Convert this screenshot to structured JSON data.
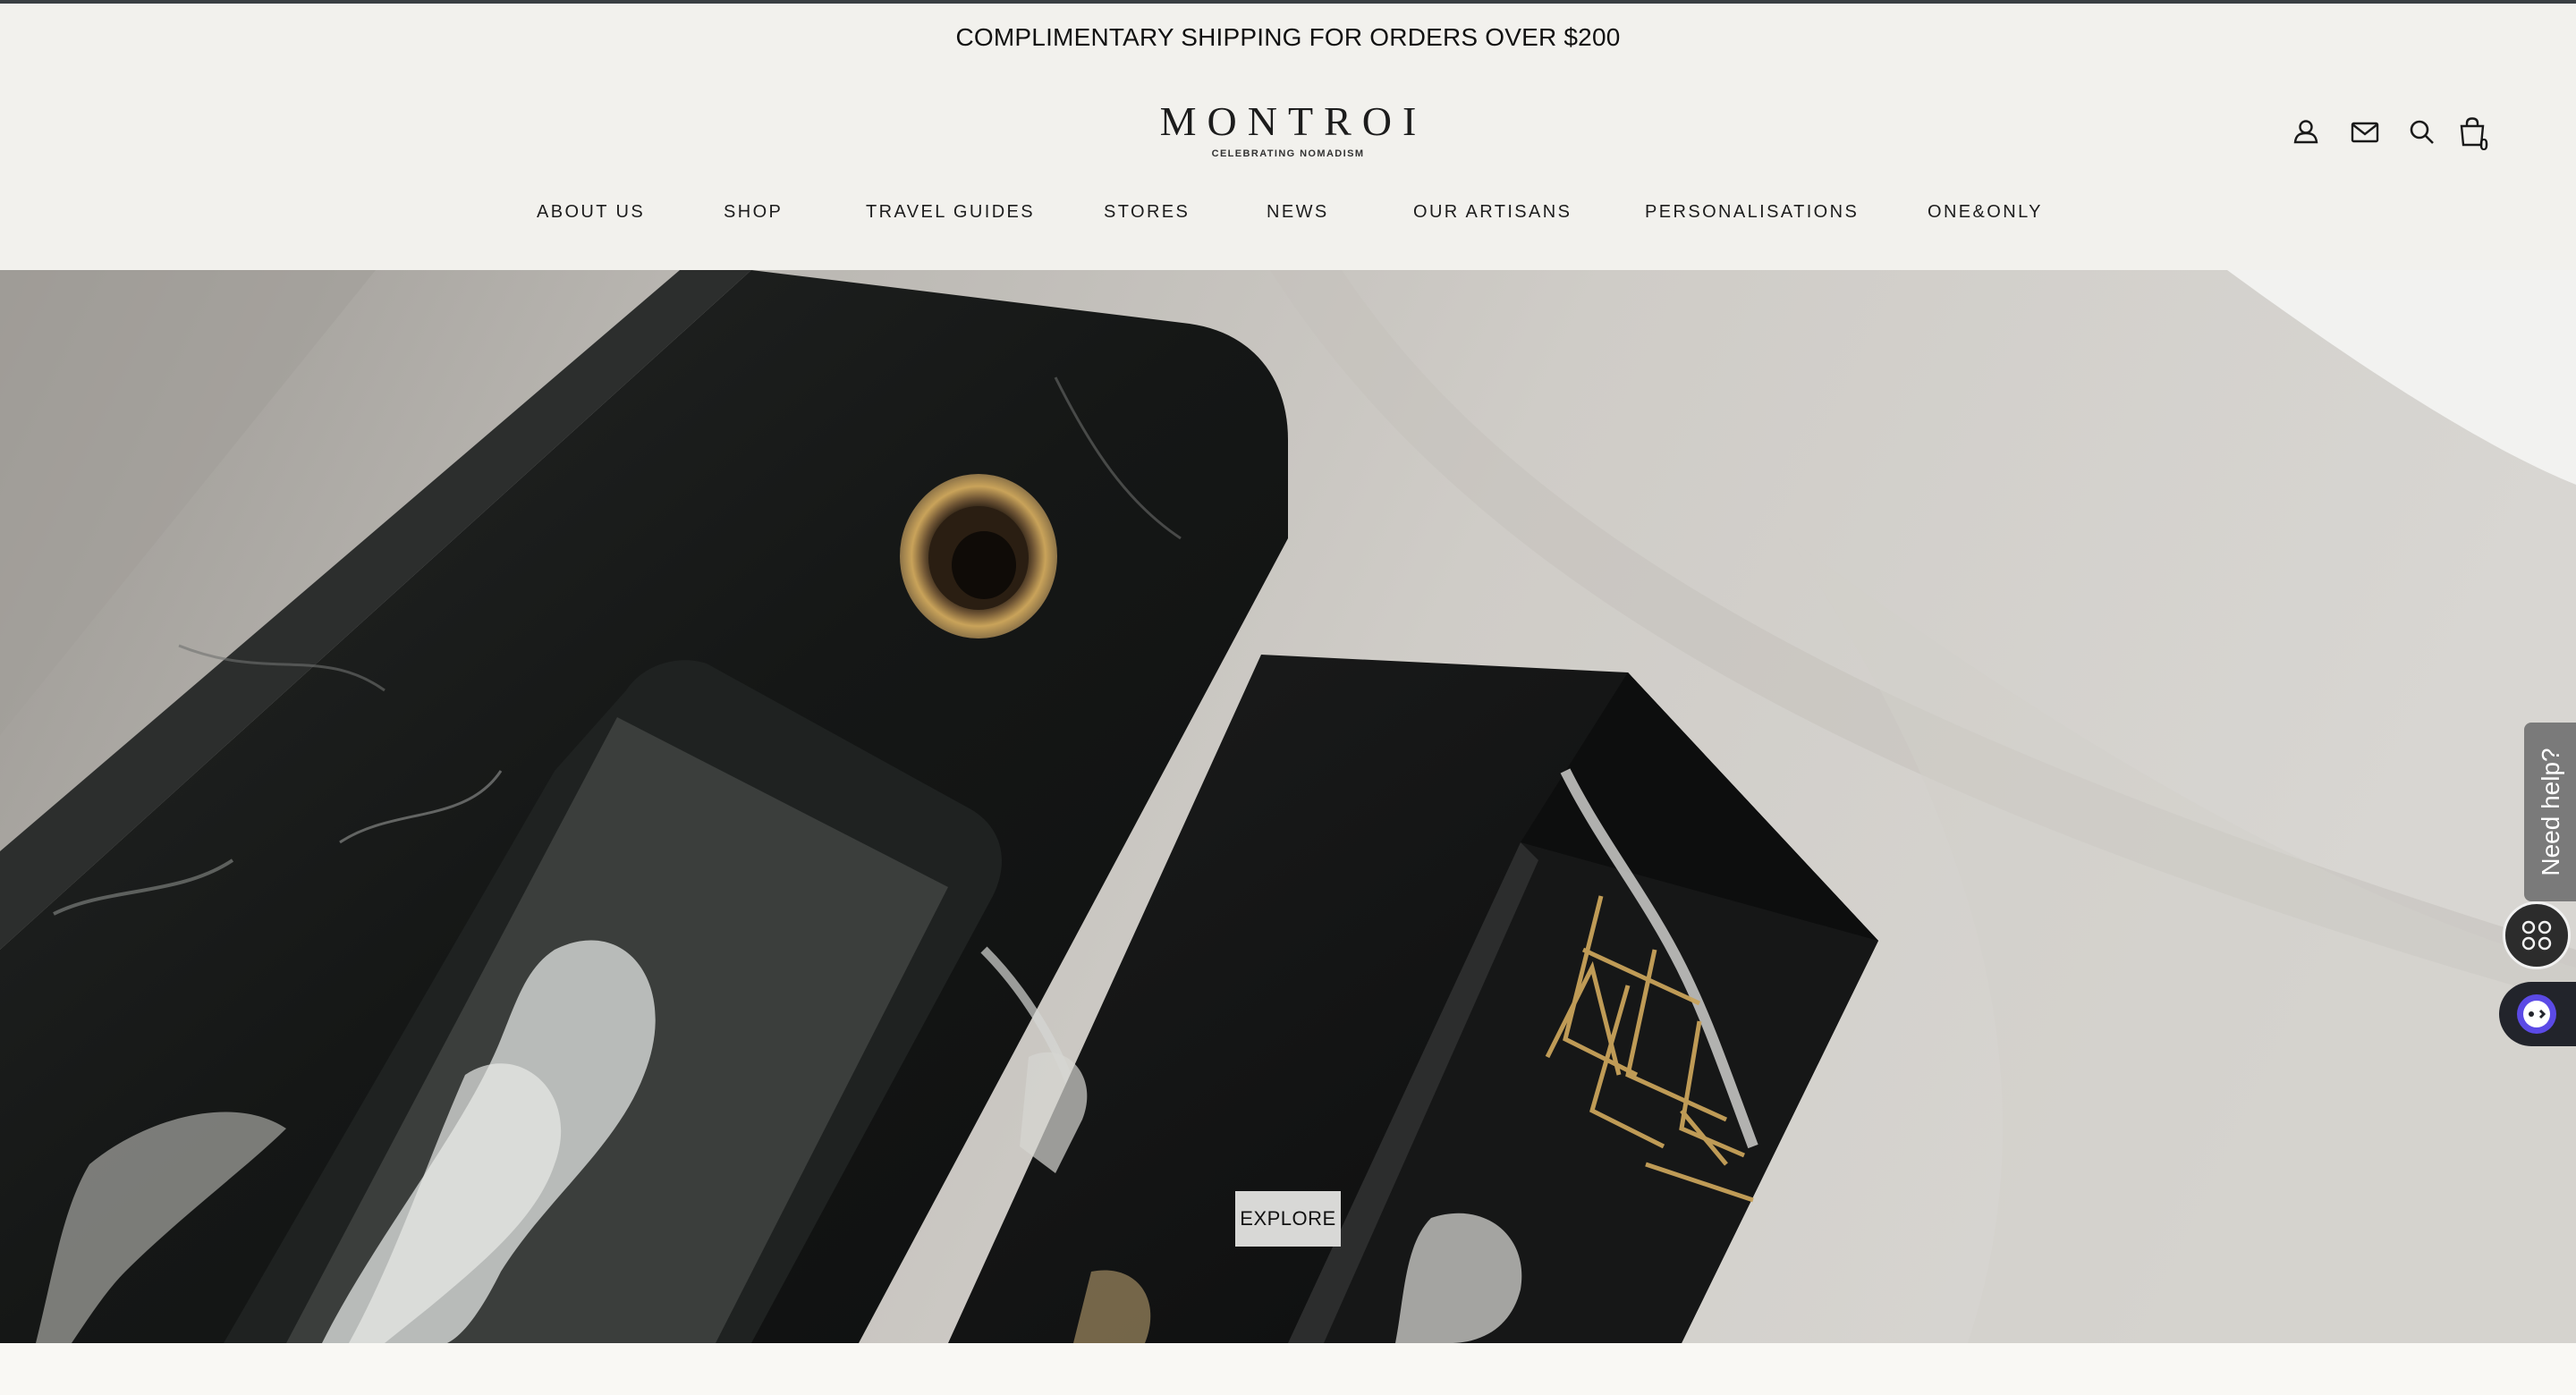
{
  "announcement": "COMPLIMENTARY SHIPPING FOR ORDERS OVER $200",
  "brand": {
    "name": "MONTROI",
    "tagline": "CELEBRATING NOMADISM"
  },
  "header_icons": [
    "account-icon",
    "mail-icon",
    "search-icon",
    "cart-icon"
  ],
  "cart": {
    "count": "0"
  },
  "nav": {
    "items": [
      {
        "label": "ABOUT US"
      },
      {
        "label": "SHOP"
      },
      {
        "label": "TRAVEL GUIDES"
      },
      {
        "label": "STORES"
      },
      {
        "label": "NEWS"
      },
      {
        "label": "OUR ARTISANS"
      },
      {
        "label": "PERSONALISATIONS"
      },
      {
        "label": "ONE&ONLY"
      }
    ]
  },
  "hero": {
    "cta_label": "EXPLORE"
  },
  "help": {
    "label": "Need help?"
  },
  "colors": {
    "top_rule": "#3a3f43",
    "header_bg": "#f2f1ed",
    "marble": "#141515",
    "brass": "#c9a35a",
    "help_tab": "#7a7a7a",
    "chat_accent": "#5b4ae6"
  }
}
